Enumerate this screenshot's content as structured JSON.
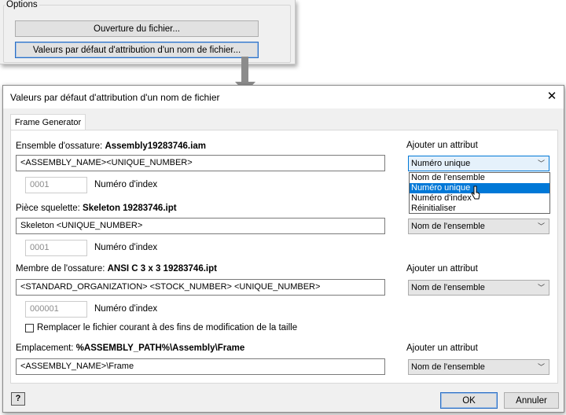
{
  "options_panel": {
    "title": "Options",
    "open_file_button": "Ouverture du fichier...",
    "defaults_button": "Valeurs par défaut d'attribution d'un nom de fichier..."
  },
  "dialog": {
    "title": "Valeurs par défaut d'attribution d'un nom de fichier",
    "tab": "Frame Generator",
    "index_label": "Numéro d'index",
    "add_attribute_label": "Ajouter un attribut",
    "assembly": {
      "label": "Ensemble d'ossature: ",
      "name": "Assembly19283746.iam",
      "pattern": "<ASSEMBLY_NAME><UNIQUE_NUMBER>",
      "index": "0001",
      "attribute_value": "Numéro unique"
    },
    "dropdown": {
      "options": [
        "Nom de l'ensemble",
        "Numéro unique",
        "Numéro d'index",
        "Réinitialiser"
      ],
      "selected_index": 1
    },
    "skeleton": {
      "label": "Pièce squelette: ",
      "name": "Skeleton 19283746.ipt",
      "pattern": "Skeleton <UNIQUE_NUMBER>",
      "index": "0001",
      "attribute_value": "Nom de l'ensemble"
    },
    "member": {
      "label": "Membre de l'ossature: ",
      "name": "ANSI C 3 x 3 19283746.ipt",
      "pattern": "<STANDARD_ORGANIZATION> <STOCK_NUMBER> <UNIQUE_NUMBER>",
      "index": "000001",
      "attribute_value": "Nom de l'ensemble"
    },
    "replace_checkbox": {
      "label": "Remplacer le fichier courant à des fins de modification de la taille",
      "checked": false
    },
    "location": {
      "label": "Emplacement: ",
      "name": "%ASSEMBLY_PATH%\\Assembly\\Frame",
      "pattern": "<ASSEMBLY_NAME>\\Frame",
      "attribute_value": "Nom de l'ensemble"
    },
    "help_label": "?",
    "ok": "OK",
    "cancel": "Annuler",
    "close_icon": "close-icon",
    "help_icon": "help-icon"
  },
  "colors": {
    "accent": "#0078d7",
    "arrow": "#8c8c8c"
  }
}
